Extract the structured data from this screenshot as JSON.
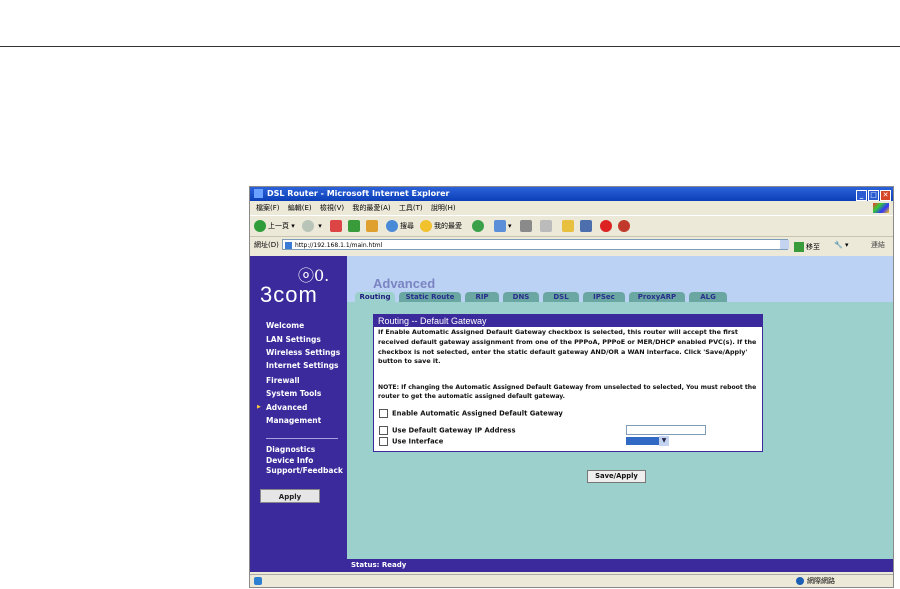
{
  "window": {
    "title": "DSL Router - Microsoft Internet Explorer"
  },
  "menubar": {
    "items": [
      "檔案(F)",
      "編輯(E)",
      "檢視(V)",
      "我的最愛(A)",
      "工具(T)",
      "說明(H)"
    ]
  },
  "toolbar": {
    "back": "上一頁",
    "search": "搜尋",
    "favorites": "我的最愛"
  },
  "addressbar": {
    "label": "網址(D)",
    "url": "http://192.168.1.1/main.html",
    "go": "移至",
    "links": "連結"
  },
  "sidebar": {
    "logo_text": "3com",
    "logo_mark": "ⓞ0.",
    "items": [
      {
        "label": "Welcome"
      },
      {
        "label": "LAN Settings"
      },
      {
        "label": "Wireless Settings"
      },
      {
        "label": "Internet Settings"
      },
      {
        "label": "Firewall"
      },
      {
        "label": "System Tools"
      },
      {
        "label": "Advanced"
      },
      {
        "label": "Management"
      },
      {
        "label": "Diagnostics"
      },
      {
        "label": "Device Info"
      },
      {
        "label": "Support/Feedback"
      }
    ],
    "selected": "Advanced",
    "apply_label": "Apply"
  },
  "header": {
    "title": "Advanced"
  },
  "tabs": [
    {
      "label": "Routing",
      "active": true
    },
    {
      "label": "Static Route"
    },
    {
      "label": "RIP"
    },
    {
      "label": "DNS"
    },
    {
      "label": "DSL"
    },
    {
      "label": "IPSec"
    },
    {
      "label": "ProxyARP"
    },
    {
      "label": "ALG"
    }
  ],
  "panel": {
    "title": "Routing -- Default Gateway",
    "description": "If Enable Automatic Assigned Default Gateway checkbox is selected, this router will accept the first received default gateway assignment from one of the PPPoA, PPPoE or MER/DHCP enabled PVC(s). If the checkbox is not selected, enter the static default gateway AND/OR a WAN interface. Click 'Save/Apply' button to save it.",
    "note": "NOTE: If changing the Automatic Assigned Default Gateway from unselected to selected, You must reboot the router to get the automatic assigned default gateway.",
    "cb_auto": "Enable Automatic Assigned Default Gateway",
    "cb_ip": "Use Default Gateway IP Address",
    "cb_if": "Use Interface",
    "ip_value": ""
  },
  "save_label": "Save/Apply",
  "status": "Status: Ready",
  "ie_status": {
    "zone": "網際網路"
  }
}
